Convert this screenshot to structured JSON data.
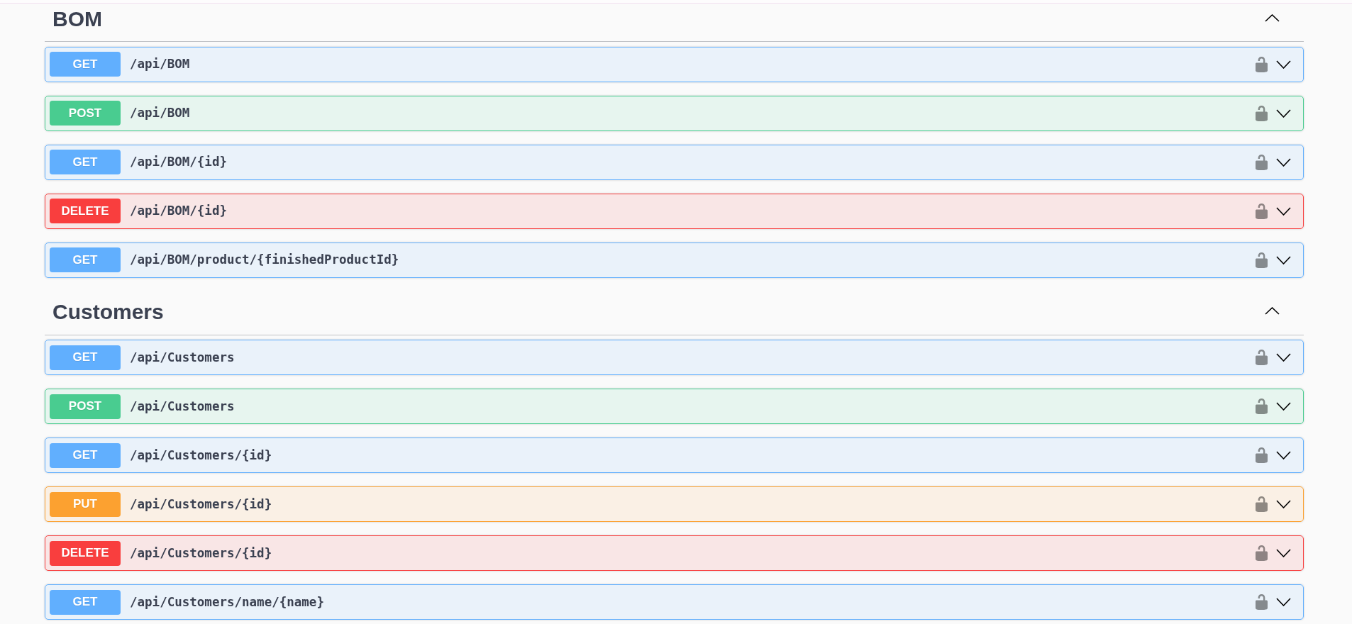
{
  "sections": [
    {
      "name": "BOM",
      "expanded": true,
      "operations": [
        {
          "method": "GET",
          "color": "#61affe",
          "path": "/api/BOM",
          "authorized": false,
          "expanded": false
        },
        {
          "method": "POST",
          "color": "#49cc90",
          "path": "/api/BOM",
          "authorized": false,
          "expanded": false
        },
        {
          "method": "GET",
          "color": "#61affe",
          "path": "/api/BOM/{id}",
          "authorized": false,
          "expanded": false
        },
        {
          "method": "DELETE",
          "color": "#f93e3e",
          "path": "/api/BOM/{id}",
          "authorized": false,
          "expanded": false
        },
        {
          "method": "GET",
          "color": "#61affe",
          "path": "/api/BOM/product/{finishedProductId}",
          "authorized": false,
          "expanded": false
        }
      ]
    },
    {
      "name": "Customers",
      "expanded": true,
      "operations": [
        {
          "method": "GET",
          "color": "#61affe",
          "path": "/api/Customers",
          "authorized": false,
          "expanded": false
        },
        {
          "method": "POST",
          "color": "#49cc90",
          "path": "/api/Customers",
          "authorized": false,
          "expanded": false
        },
        {
          "method": "GET",
          "color": "#61affe",
          "path": "/api/Customers/{id}",
          "authorized": false,
          "expanded": false
        },
        {
          "method": "PUT",
          "color": "#fca130",
          "path": "/api/Customers/{id}",
          "authorized": false,
          "expanded": false
        },
        {
          "method": "DELETE",
          "color": "#f93e3e",
          "path": "/api/Customers/{id}",
          "authorized": false,
          "expanded": false
        },
        {
          "method": "GET",
          "color": "#61affe",
          "path": "/api/Customers/name/{name}",
          "authorized": false,
          "expanded": false
        }
      ]
    }
  ]
}
